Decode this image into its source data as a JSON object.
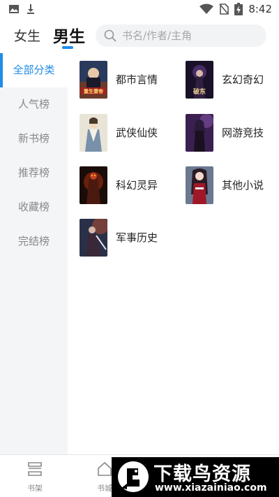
{
  "status_bar": {
    "time": "8:42",
    "icons": [
      "image-icon",
      "download-icon",
      "wifi-icon",
      "no-sim-icon",
      "battery-icon"
    ]
  },
  "header": {
    "tab_female": "女生",
    "tab_male": "男生",
    "active_tab": "男生",
    "search_placeholder": "书名/作者/主角"
  },
  "sidebar": {
    "items": [
      {
        "label": "全部分类",
        "active": true
      },
      {
        "label": "人气榜",
        "active": false
      },
      {
        "label": "新书榜",
        "active": false
      },
      {
        "label": "推荐榜",
        "active": false
      },
      {
        "label": "收藏榜",
        "active": false
      },
      {
        "label": "完结榜",
        "active": false
      }
    ]
  },
  "categories": [
    {
      "label": "都市言情",
      "cover_title": "重生萧帝"
    },
    {
      "label": "玄幻奇幻",
      "cover_title": "破东"
    },
    {
      "label": "武侠仙侠"
    },
    {
      "label": "网游竞技"
    },
    {
      "label": "科幻灵异"
    },
    {
      "label": "其他小说"
    },
    {
      "label": "军事历史"
    }
  ],
  "bottom_nav": {
    "items": [
      {
        "label": "书架",
        "icon": "bookshelf-icon"
      },
      {
        "label": "书城",
        "icon": "store-icon"
      }
    ]
  },
  "watermark": {
    "title": "下载鸟资源",
    "url": "www.xiazainiao.com"
  },
  "colors": {
    "accent": "#1f8ce8",
    "sidebar_bg": "#f4f5f7",
    "search_bg": "#f2f3f5"
  }
}
